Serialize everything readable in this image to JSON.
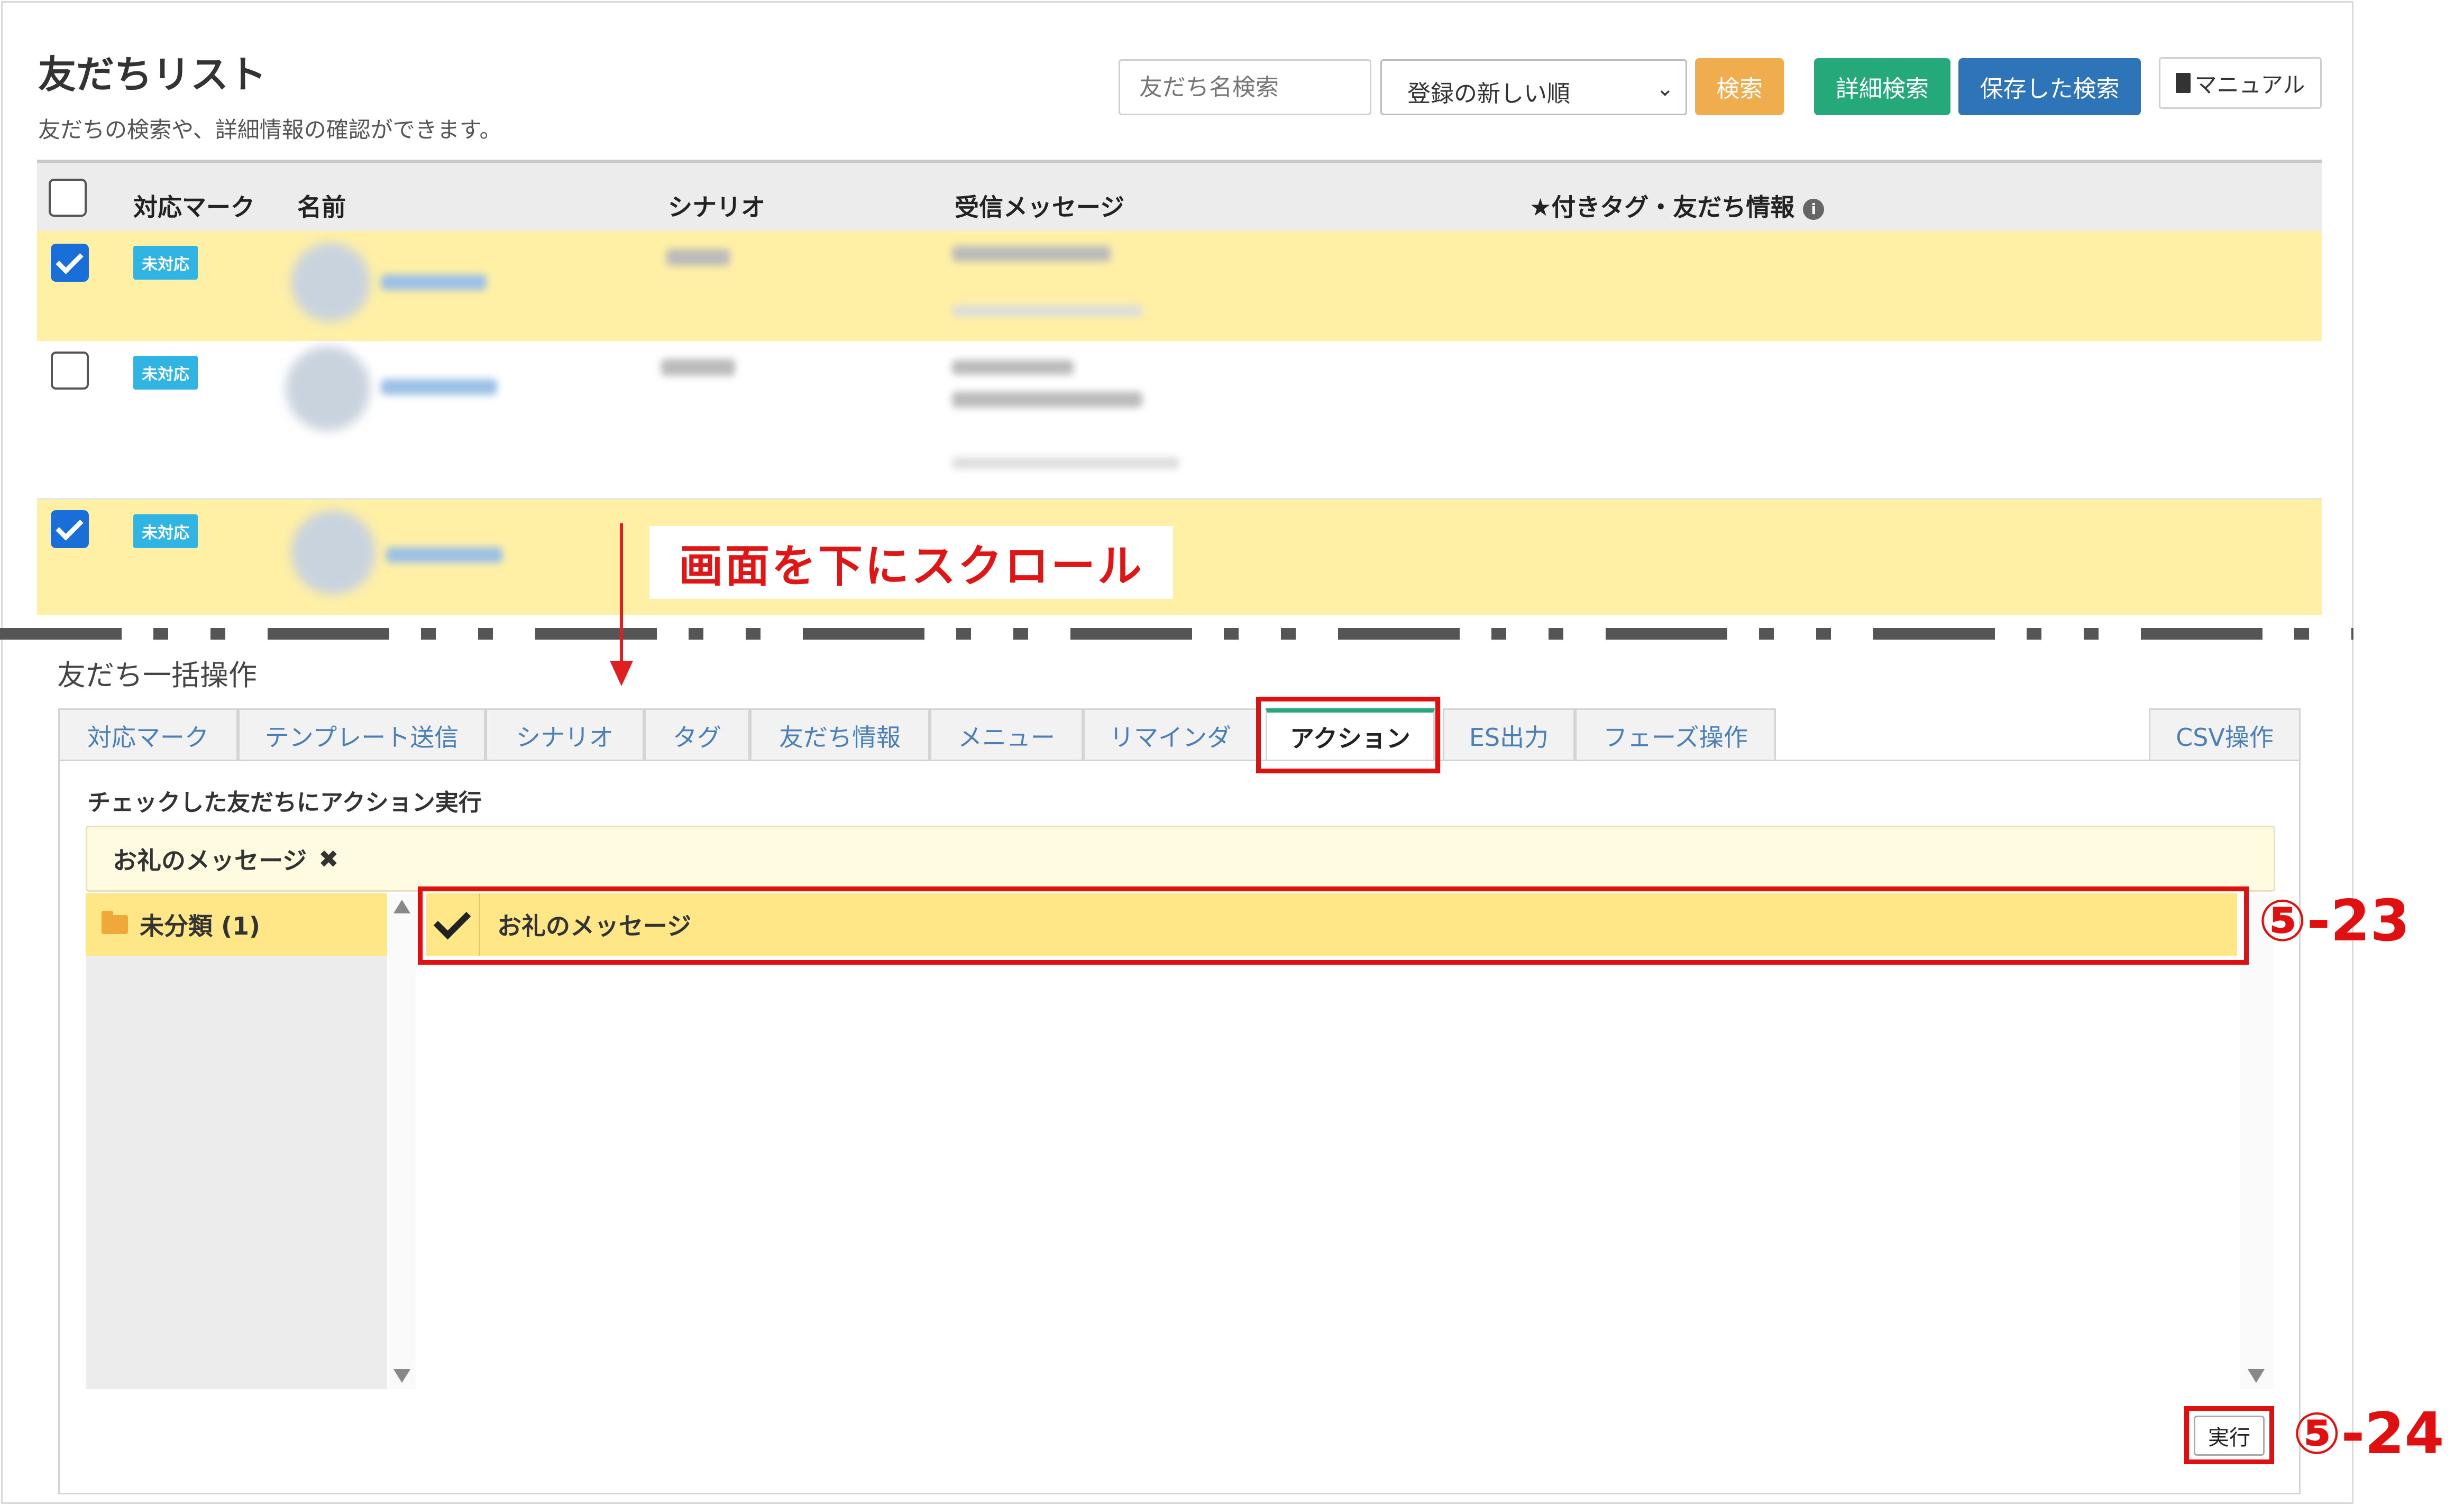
{
  "header": {
    "title": "友だちリスト",
    "subtitle": "友だちの検索や、詳細情報の確認ができます。",
    "search_placeholder": "友だち名検索",
    "sort_value": "登録の新しい順",
    "search_button": "検索",
    "detail_search_button": "詳細検索",
    "saved_search_button": "保存した検索",
    "manual_button": "マニュアル"
  },
  "table": {
    "columns": [
      "対応マーク",
      "名前",
      "シナリオ",
      "受信メッセージ",
      "★付きタグ・友だち情報"
    ],
    "rows": [
      {
        "checked": true,
        "badge": "未対応"
      },
      {
        "checked": false,
        "badge": "未対応"
      },
      {
        "checked": true,
        "badge": "未対応"
      }
    ]
  },
  "scroll_note": "画面を下にスクロール",
  "bulk": {
    "title": "友だち一括操作",
    "tabs": [
      "対応マーク",
      "テンプレート送信",
      "シナリオ",
      "タグ",
      "友だち情報",
      "メニュー",
      "リマインダ",
      "アクション",
      "ES出力",
      "フェーズ操作",
      "CSV操作"
    ],
    "active_tab": "アクション",
    "panel_label": "チェックした友だちにアクション実行",
    "selected_chip": "お礼のメッセージ",
    "folder": "未分類 (1)",
    "action_item": "お礼のメッセージ",
    "run_button": "実行"
  },
  "annotations": {
    "item_step": "⑤-23",
    "run_step": "⑤-24"
  },
  "colors": {
    "accent_red": "#e01010",
    "row_highlight": "#fff0a6",
    "badge": "#2fb4e4",
    "btn_search": "#f0ad4e",
    "btn_detail": "#26a97a",
    "btn_saved": "#2d74b8"
  }
}
